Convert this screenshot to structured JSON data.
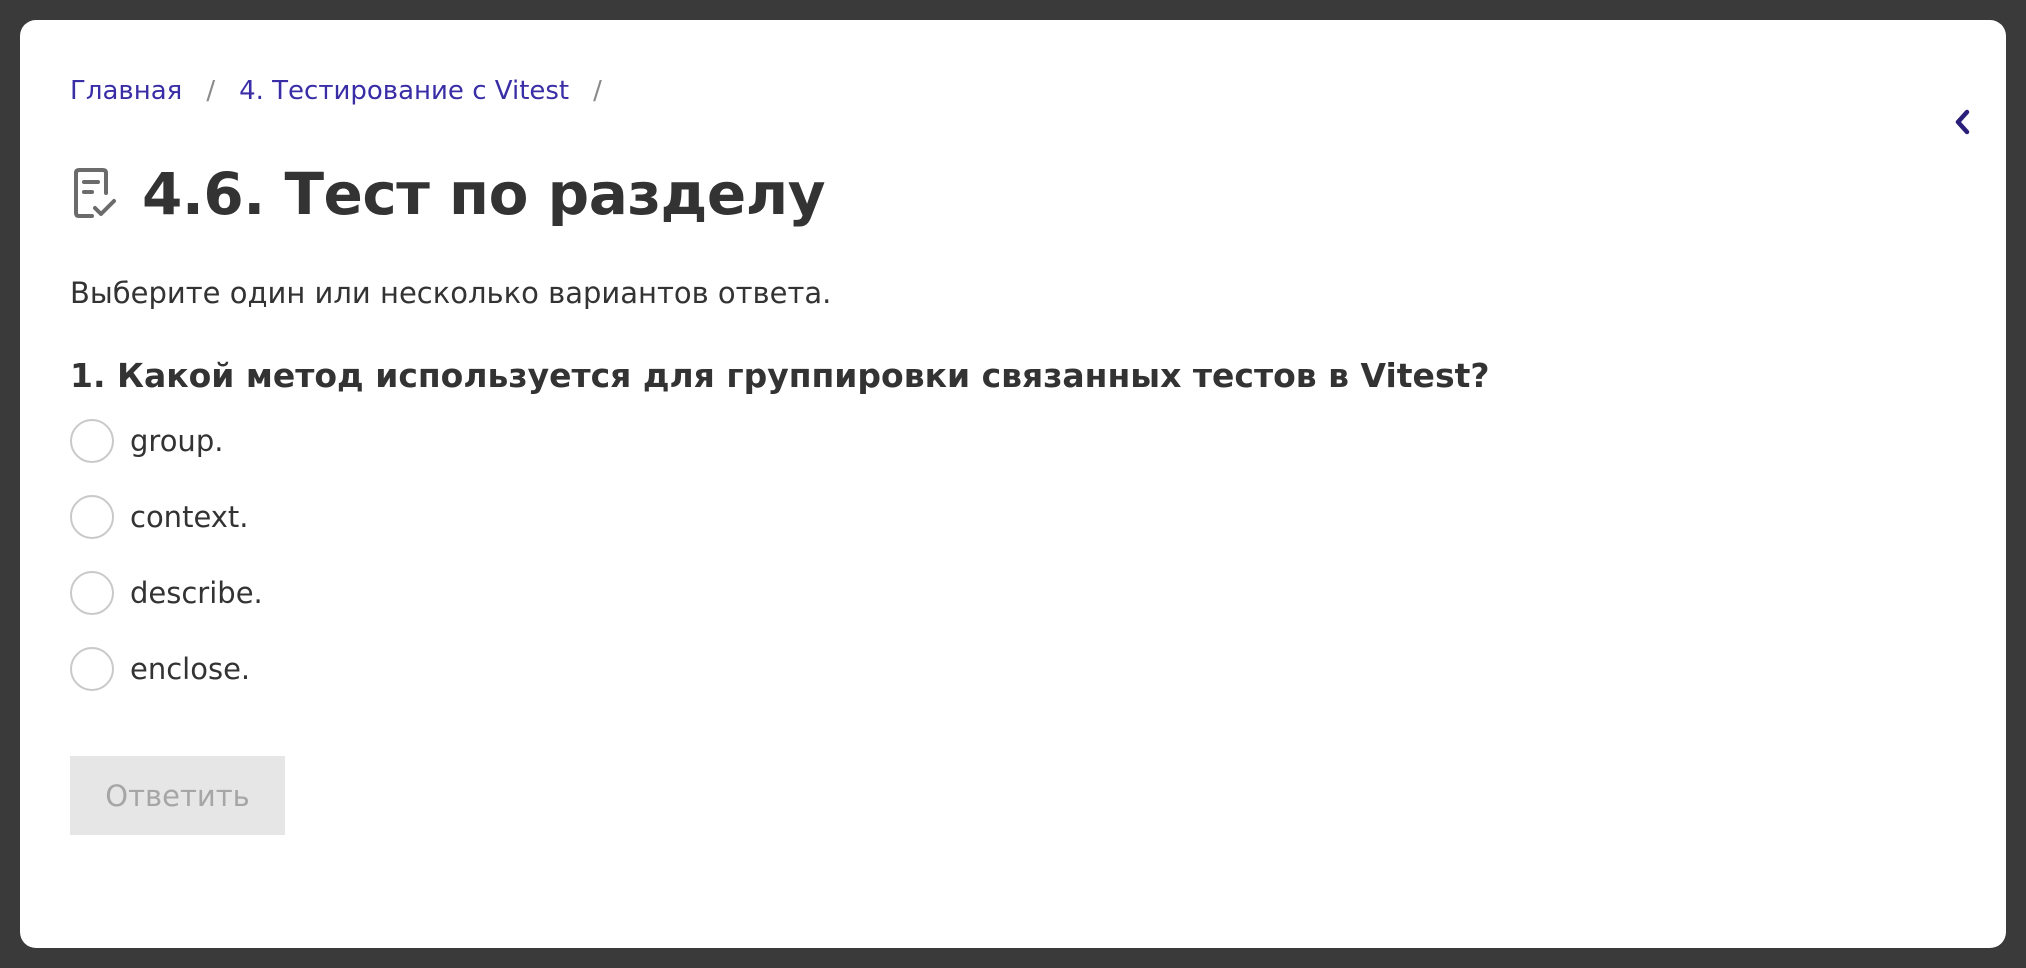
{
  "breadcrumb": {
    "items": [
      {
        "label": "Главная"
      },
      {
        "label": "4. Тестирование с Vitest"
      }
    ],
    "separator": "/"
  },
  "page": {
    "icon": "checklist-icon",
    "title": "4.6. Тест по разделу",
    "instructions": "Выберите один или несколько вариантов ответа."
  },
  "quiz": {
    "question": "1. Какой метод используется для группировки связанных тестов в Vitest?",
    "options": [
      {
        "label": "group.",
        "selected": false
      },
      {
        "label": "context.",
        "selected": false
      },
      {
        "label": "describe.",
        "selected": false
      },
      {
        "label": "enclose.",
        "selected": false
      }
    ],
    "submit_label": "Ответить",
    "submit_enabled": false
  },
  "colors": {
    "link": "#3a2ea6",
    "text": "#333333",
    "frame": "#3a3a3a",
    "button_disabled_bg": "#e6e6e6",
    "button_disabled_text": "#a6a6a6",
    "chevron": "#2a1f7a"
  },
  "collapse": {
    "icon": "chevron-left-icon"
  }
}
